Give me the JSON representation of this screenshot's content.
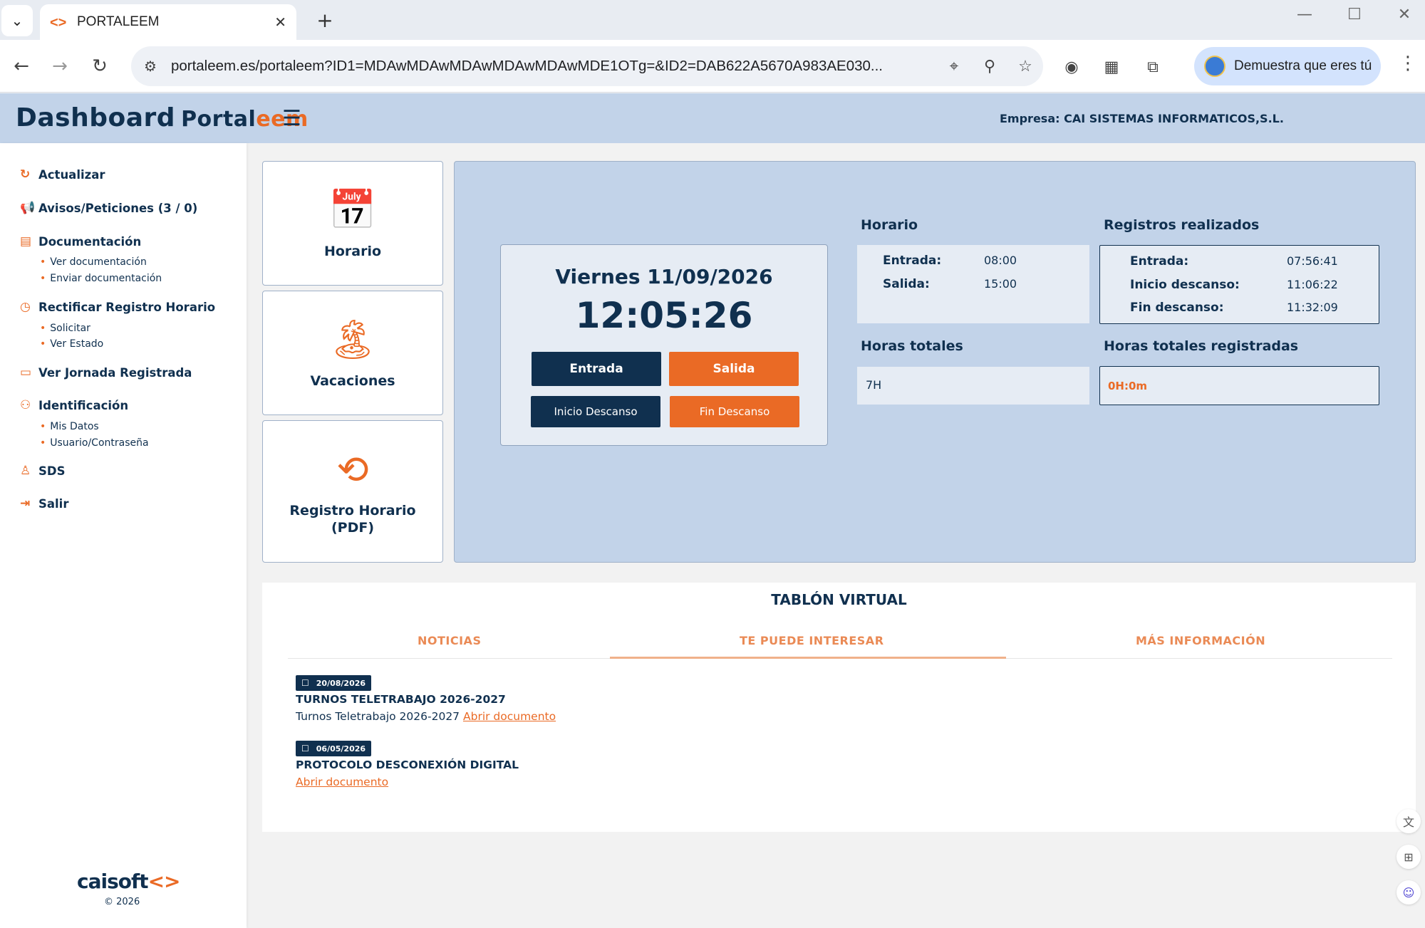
{
  "browser": {
    "tab_title": "PORTALEEM",
    "url": "portaleem.es/portaleem?ID1=MDAwMDAwMDAwMDAwMDAwMDE1OTg=&ID2=DAB622A5670A983AE030...",
    "profile_label": "Demuestra que eres tú"
  },
  "header": {
    "brand_part1": "Dashboard",
    "brand_part2": "Portal",
    "brand_part3": "eem",
    "empresa": "Empresa: CAI SISTEMAS INFORMATICOS,S.L."
  },
  "sidebar": {
    "items": [
      {
        "label": "Actualizar"
      },
      {
        "label": "Avisos/Peticiones (3 / 0)"
      },
      {
        "label": "Documentación",
        "sub": [
          "Ver documentación",
          "Enviar documentación"
        ]
      },
      {
        "label": "Rectificar Registro Horario",
        "sub": [
          "Solicitar",
          "Ver Estado"
        ]
      },
      {
        "label": "Ver Jornada Registrada"
      },
      {
        "label": "Identificación",
        "sub": [
          "Mis Datos",
          "Usuario/Contraseña"
        ]
      },
      {
        "label": "SDS"
      },
      {
        "label": "Salir"
      }
    ],
    "footer_logo": "caisoft",
    "footer_copy": "© 2026"
  },
  "cards": [
    {
      "label": "Horario",
      "icon": "calendar-clock-icon"
    },
    {
      "label": "Vacaciones",
      "icon": "palm-island-icon"
    },
    {
      "label": "Registro Horario (PDF)",
      "icon": "history-clock-icon"
    }
  ],
  "clock": {
    "date": "Viernes 11/09/2026",
    "time": "12:05:26",
    "btn_entrada": "Entrada",
    "btn_salida": "Salida",
    "btn_inicio_descanso": "Inicio Descanso",
    "btn_fin_descanso": "Fin Descanso"
  },
  "horario": {
    "title": "Horario",
    "entrada_label": "Entrada:",
    "entrada_value": "08:00",
    "salida_label": "Salida:",
    "salida_value": "15:00"
  },
  "registros": {
    "title": "Registros realizados",
    "rows": [
      {
        "label": "Entrada:",
        "value": "07:56:41"
      },
      {
        "label": "Inicio descanso:",
        "value": "11:06:22"
      },
      {
        "label": "Fin descanso:",
        "value": "11:32:09"
      }
    ]
  },
  "horas_totales": {
    "title": "Horas totales",
    "value": "7H"
  },
  "horas_registradas": {
    "title": "Horas totales registradas",
    "value": "0H:0m"
  },
  "tablon": {
    "title": "TABLÓN VIRTUAL",
    "tabs": [
      "NOTICIAS",
      "TE PUEDE INTERESAR",
      "MÁS INFORMACIÓN"
    ],
    "active_tab": "TE PUEDE INTERESAR",
    "news": [
      {
        "date": "20/08/2026",
        "title": "TURNOS TELETRABAJO 2026-2027",
        "body": "Turnos Teletrabajo 2026-2027",
        "link": "Abrir documento"
      },
      {
        "date": "06/05/2026",
        "title": "PROTOCOLO DESCONEXIÓN DIGITAL",
        "body": "",
        "link": "Abrir documento"
      }
    ]
  },
  "colors": {
    "navy": "#10304f",
    "orange": "#ea6a25",
    "panel": "#c2d3e9"
  }
}
